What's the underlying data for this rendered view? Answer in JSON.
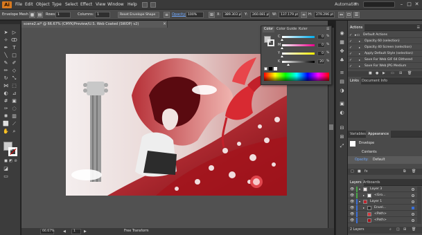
{
  "app": {
    "logo": "Ai"
  },
  "menu": [
    "File",
    "Edit",
    "Object",
    "Type",
    "Select",
    "Effect",
    "View",
    "Window",
    "Help"
  ],
  "workspace": "Automation",
  "window_controls": [
    "–",
    "□",
    "✕"
  ],
  "control_bar": {
    "selection": "Envelope Mesh",
    "rows_label": "Rows:",
    "rows_value": "1",
    "columns_label": "Columns:",
    "columns_value": "1",
    "reset_button": "Reset Envelope Shape",
    "opacity_label": "Opacity:",
    "opacity_value": "100%",
    "x_label": "X:",
    "x_value": "389.303 pt",
    "y_label": "Y:",
    "y_value": "260.081 pt",
    "w_label": "W:",
    "w_value": "137.179 pt",
    "h_label": "H:",
    "h_value": "279.296 pt"
  },
  "document": {
    "tab_title": "scene2.ai* @ 66.67% (CMYK/Preview/U.S. Web Coated (SWOP) v2)",
    "zoom": "66.67%",
    "page": "1",
    "status_tool": "Free Transform"
  },
  "color_panel": {
    "tabs": [
      "Color",
      "Color Guide",
      "Kuler"
    ],
    "sliders": [
      {
        "label": "C",
        "value": "0"
      },
      {
        "label": "M",
        "value": "0"
      },
      {
        "label": "Y",
        "value": "0"
      },
      {
        "label": "K",
        "value": "20"
      }
    ],
    "percent": "%"
  },
  "actions_panel": {
    "tabs": [
      "Actions"
    ],
    "items": [
      "Default Actions",
      "Opacity 60 (selection)",
      "Opacity 40 Screen (selection)",
      "Apply Default Style (selection)",
      "Save For Web GIF 64 Dithered",
      "Save For Web JPG Medium"
    ]
  },
  "links_panel": {
    "tabs": [
      "Links",
      "Document Info"
    ]
  },
  "appearance_panel": {
    "tabs": [
      "Variables",
      "Appearance"
    ],
    "title": "Envelope",
    "contents": "Contents",
    "opacity_label": "Opacity:",
    "opacity_value": "Default"
  },
  "layers_panel": {
    "tabs": [
      "Layers",
      "Artboards"
    ],
    "rows": [
      "Layer 3",
      "<Gro...",
      "Layer 1",
      "Envel...",
      "<Path>",
      "<Path>"
    ],
    "footer": "2 Layers"
  },
  "colors": {
    "accent": "#d97a1f",
    "canvas_red": "#c0262f",
    "layer3_color": "#4aa84a",
    "layer1_color": "#3a6fd8"
  }
}
